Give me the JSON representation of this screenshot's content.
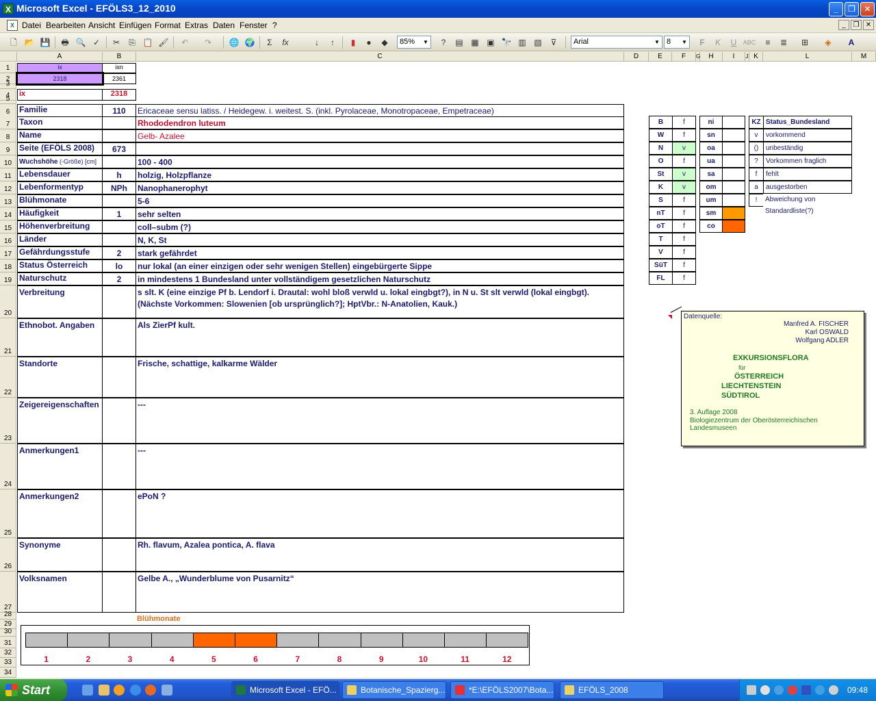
{
  "window": {
    "title": "Microsoft Excel - EFÖLS3_12_2010"
  },
  "menu": {
    "items": [
      "Datei",
      "Bearbeiten",
      "Ansicht",
      "Einfügen",
      "Format",
      "Extras",
      "Daten",
      "Fenster",
      "?"
    ]
  },
  "toolbar": {
    "zoom": "85%",
    "font": "Arial",
    "size": "8"
  },
  "columns": [
    "A",
    "B",
    "C",
    "D",
    "E",
    "F",
    "G",
    "H",
    "I",
    "J",
    "K",
    "L",
    "M"
  ],
  "top": {
    "a1": "ix",
    "b1": "ixn",
    "a2": "2318",
    "b2": "2361",
    "a4": "ix",
    "b4": "2318"
  },
  "rows": [
    {
      "num": "6",
      "label": "Familie",
      "b": "110",
      "c": "Ericaceae sensu latiss.  /  Heidegew. i. weitest. S. (inkl. Pyrolaceae, Monotropaceae, Empetraceae)"
    },
    {
      "num": "7",
      "label": "Taxon",
      "b": "",
      "c": "Rhododendron luteum"
    },
    {
      "num": "8",
      "label": "Name",
      "b": "",
      "c": "Gelb- Azalee"
    },
    {
      "num": "9",
      "label": "Seite (EFÖLS 2008)",
      "b": "673",
      "c": ""
    },
    {
      "num": "10",
      "label": "Wuchshöhe",
      "label_suffix": "(-Größe) [cm]",
      "b": "",
      "c": " 100 - 400"
    },
    {
      "num": "11",
      "label": "Lebensdauer",
      "b": "h",
      "c": "holzig, Holzpflanze"
    },
    {
      "num": "12",
      "label": "Lebenformentyp",
      "b": "NPh",
      "c": "Nanophanerophyt"
    },
    {
      "num": "13",
      "label": "Blühmonate",
      "b": "",
      "c": " 5-6"
    },
    {
      "num": "14",
      "label": "Häufigkeit",
      "b": "1",
      "c": "sehr selten"
    },
    {
      "num": "15",
      "label": "Höhenverbreitung",
      "b": "",
      "c": "coll–subm (?)"
    },
    {
      "num": "16",
      "label": "Länder",
      "b": "",
      "c": "N, K, St"
    },
    {
      "num": "17",
      "label": "Gefährdungsstufe",
      "b": "2",
      "c": "stark gefährdet"
    },
    {
      "num": "18",
      "label": "Status Österreich",
      "b": "lo",
      "c": "nur lokal (an einer einzigen oder sehr wenigen Stellen) eingebürgerte Sippe"
    },
    {
      "num": "19",
      "label": "Naturschutz",
      "b": "2",
      "c": "in mindestens 1 Bundesland unter vollständigem gesetzlichen Naturschutz"
    }
  ],
  "tall_rows": [
    {
      "num": "20",
      "label": "Verbreitung",
      "c": "s slt. K (eine einzige Pf b. Lendorf i. Drautal: wohl bloß verwld u. lokal eingbgt?), in N u. St slt verwld (lokal eingbgt). (Nächste Vorkommen: Slowenien [ob ursprünglich?]; HptVbr.: N-Anatolien, Kauk.)"
    },
    {
      "num": "21",
      "label": "Ethnobot. Angaben",
      "c": "Als ZierPf kult."
    },
    {
      "num": "22",
      "label": "Standorte",
      "c": "Frische, schattige, kalkarme Wälder"
    },
    {
      "num": "23",
      "label": "Zeigereigenschaften",
      "c": "---"
    },
    {
      "num": "24",
      "label": "Anmerkungen1",
      "c": "---"
    },
    {
      "num": "25",
      "label": "Anmerkungen2",
      "c": "ePoN ?"
    },
    {
      "num": "26",
      "label": "Synonyme",
      "c": "Rh. flavum, Azalea pontica, A. flava"
    },
    {
      "num": "27",
      "label": "Volksnamen",
      "c": "Gelbe A., „Wunderblume von Pusarnitz“"
    }
  ],
  "bundeslaender": [
    {
      "code": "B",
      "s": "f"
    },
    {
      "code": "W",
      "s": "f"
    },
    {
      "code": "N",
      "s": "v"
    },
    {
      "code": "O",
      "s": "f"
    },
    {
      "code": "St",
      "s": "v"
    },
    {
      "code": "K",
      "s": "v"
    },
    {
      "code": "S",
      "s": "f"
    },
    {
      "code": "nT",
      "s": "f"
    },
    {
      "code": "oT",
      "s": "f"
    },
    {
      "code": "T",
      "s": "f"
    },
    {
      "code": "V",
      "s": "f"
    },
    {
      "code": "SüT",
      "s": "f"
    },
    {
      "code": "FL",
      "s": "f"
    }
  ],
  "hoehenstufen": [
    {
      "code": "ni",
      "on": false
    },
    {
      "code": "sn",
      "on": false
    },
    {
      "code": "oa",
      "on": false
    },
    {
      "code": "ua",
      "on": false
    },
    {
      "code": "sa",
      "on": false
    },
    {
      "code": "om",
      "on": false
    },
    {
      "code": "um",
      "on": false
    },
    {
      "code": "sm",
      "on": true
    },
    {
      "code": "co",
      "on": true
    }
  ],
  "legend": {
    "header_kz": "KZ",
    "header_text": "Status_Bundesland",
    "items": [
      {
        "kz": "v",
        "text": "vorkommend"
      },
      {
        "kz": "()",
        "text": "unbeständig"
      },
      {
        "kz": "?",
        "text": "Vorkommen fraglich"
      },
      {
        "kz": "f",
        "text": "fehlt"
      },
      {
        "kz": "a",
        "text": "ausgestorben"
      },
      {
        "kz": "!",
        "text": "Abweichung von Standardliste(?)"
      }
    ]
  },
  "note": {
    "source": "Datenquelle:",
    "authors": [
      "Manfred A. FISCHER",
      "Karl OSWALD",
      "Wolfgang ADLER"
    ],
    "title1": "EXKURSIONSFLORA",
    "fuer": "für",
    "countries": [
      "ÖSTERREICH",
      "LIECHTENSTEIN",
      "SÜDTIROL"
    ],
    "edition": "3. Auflage 2008",
    "publisher": "Biologiezentrum der Oberösterreichischen Landesmuseen"
  },
  "months": {
    "title": "Blühmonate",
    "labels": [
      "1",
      "2",
      "3",
      "4",
      "5",
      "6",
      "7",
      "8",
      "9",
      "10",
      "11",
      "12"
    ],
    "active": [
      5,
      6
    ]
  },
  "row_numbers_extra": [
    "1",
    "2",
    "3",
    "4",
    "5",
    "28",
    "29",
    "30",
    "31",
    "32",
    "33",
    "34"
  ],
  "taskbar": {
    "start": "Start",
    "items": [
      "Microsoft Excel - EFÖ...",
      "Botanische_Spazierg...",
      "*E:\\EFÖLS2007\\Bota...",
      "EFÖLS_2008"
    ],
    "clock": "09:48"
  },
  "colors": {
    "accent_red": "#c8102e",
    "navy": "#1a1a6e",
    "orange": "#ff6600",
    "green_cell": "#ccffcc",
    "purple_cell": "#cc99ff"
  }
}
